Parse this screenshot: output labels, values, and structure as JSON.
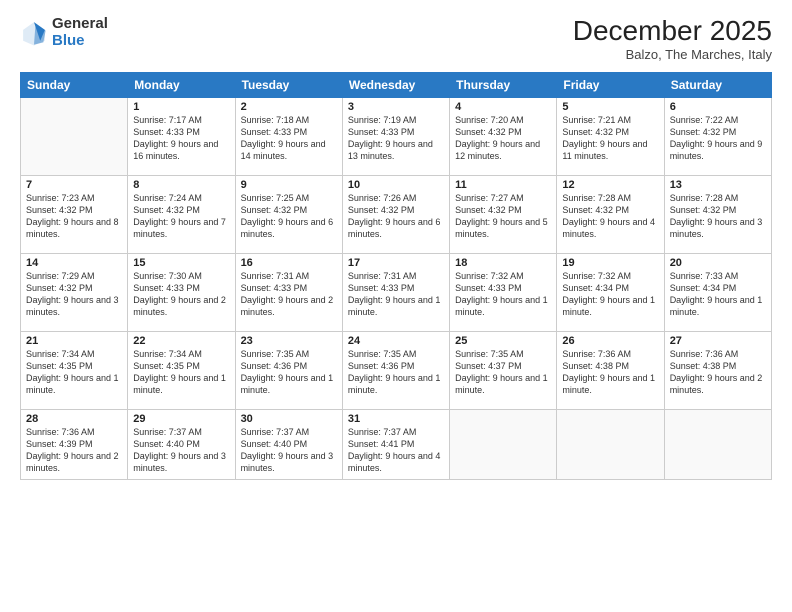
{
  "logo": {
    "general": "General",
    "blue": "Blue"
  },
  "header": {
    "title": "December 2025",
    "subtitle": "Balzo, The Marches, Italy"
  },
  "weekdays": [
    "Sunday",
    "Monday",
    "Tuesday",
    "Wednesday",
    "Thursday",
    "Friday",
    "Saturday"
  ],
  "weeks": [
    [
      {
        "day": "",
        "sunrise": "",
        "sunset": "",
        "daylight": ""
      },
      {
        "day": "1",
        "sunrise": "Sunrise: 7:17 AM",
        "sunset": "Sunset: 4:33 PM",
        "daylight": "Daylight: 9 hours and 16 minutes."
      },
      {
        "day": "2",
        "sunrise": "Sunrise: 7:18 AM",
        "sunset": "Sunset: 4:33 PM",
        "daylight": "Daylight: 9 hours and 14 minutes."
      },
      {
        "day": "3",
        "sunrise": "Sunrise: 7:19 AM",
        "sunset": "Sunset: 4:33 PM",
        "daylight": "Daylight: 9 hours and 13 minutes."
      },
      {
        "day": "4",
        "sunrise": "Sunrise: 7:20 AM",
        "sunset": "Sunset: 4:32 PM",
        "daylight": "Daylight: 9 hours and 12 minutes."
      },
      {
        "day": "5",
        "sunrise": "Sunrise: 7:21 AM",
        "sunset": "Sunset: 4:32 PM",
        "daylight": "Daylight: 9 hours and 11 minutes."
      },
      {
        "day": "6",
        "sunrise": "Sunrise: 7:22 AM",
        "sunset": "Sunset: 4:32 PM",
        "daylight": "Daylight: 9 hours and 9 minutes."
      }
    ],
    [
      {
        "day": "7",
        "sunrise": "Sunrise: 7:23 AM",
        "sunset": "Sunset: 4:32 PM",
        "daylight": "Daylight: 9 hours and 8 minutes."
      },
      {
        "day": "8",
        "sunrise": "Sunrise: 7:24 AM",
        "sunset": "Sunset: 4:32 PM",
        "daylight": "Daylight: 9 hours and 7 minutes."
      },
      {
        "day": "9",
        "sunrise": "Sunrise: 7:25 AM",
        "sunset": "Sunset: 4:32 PM",
        "daylight": "Daylight: 9 hours and 6 minutes."
      },
      {
        "day": "10",
        "sunrise": "Sunrise: 7:26 AM",
        "sunset": "Sunset: 4:32 PM",
        "daylight": "Daylight: 9 hours and 6 minutes."
      },
      {
        "day": "11",
        "sunrise": "Sunrise: 7:27 AM",
        "sunset": "Sunset: 4:32 PM",
        "daylight": "Daylight: 9 hours and 5 minutes."
      },
      {
        "day": "12",
        "sunrise": "Sunrise: 7:28 AM",
        "sunset": "Sunset: 4:32 PM",
        "daylight": "Daylight: 9 hours and 4 minutes."
      },
      {
        "day": "13",
        "sunrise": "Sunrise: 7:28 AM",
        "sunset": "Sunset: 4:32 PM",
        "daylight": "Daylight: 9 hours and 3 minutes."
      }
    ],
    [
      {
        "day": "14",
        "sunrise": "Sunrise: 7:29 AM",
        "sunset": "Sunset: 4:32 PM",
        "daylight": "Daylight: 9 hours and 3 minutes."
      },
      {
        "day": "15",
        "sunrise": "Sunrise: 7:30 AM",
        "sunset": "Sunset: 4:33 PM",
        "daylight": "Daylight: 9 hours and 2 minutes."
      },
      {
        "day": "16",
        "sunrise": "Sunrise: 7:31 AM",
        "sunset": "Sunset: 4:33 PM",
        "daylight": "Daylight: 9 hours and 2 minutes."
      },
      {
        "day": "17",
        "sunrise": "Sunrise: 7:31 AM",
        "sunset": "Sunset: 4:33 PM",
        "daylight": "Daylight: 9 hours and 1 minute."
      },
      {
        "day": "18",
        "sunrise": "Sunrise: 7:32 AM",
        "sunset": "Sunset: 4:33 PM",
        "daylight": "Daylight: 9 hours and 1 minute."
      },
      {
        "day": "19",
        "sunrise": "Sunrise: 7:32 AM",
        "sunset": "Sunset: 4:34 PM",
        "daylight": "Daylight: 9 hours and 1 minute."
      },
      {
        "day": "20",
        "sunrise": "Sunrise: 7:33 AM",
        "sunset": "Sunset: 4:34 PM",
        "daylight": "Daylight: 9 hours and 1 minute."
      }
    ],
    [
      {
        "day": "21",
        "sunrise": "Sunrise: 7:34 AM",
        "sunset": "Sunset: 4:35 PM",
        "daylight": "Daylight: 9 hours and 1 minute."
      },
      {
        "day": "22",
        "sunrise": "Sunrise: 7:34 AM",
        "sunset": "Sunset: 4:35 PM",
        "daylight": "Daylight: 9 hours and 1 minute."
      },
      {
        "day": "23",
        "sunrise": "Sunrise: 7:35 AM",
        "sunset": "Sunset: 4:36 PM",
        "daylight": "Daylight: 9 hours and 1 minute."
      },
      {
        "day": "24",
        "sunrise": "Sunrise: 7:35 AM",
        "sunset": "Sunset: 4:36 PM",
        "daylight": "Daylight: 9 hours and 1 minute."
      },
      {
        "day": "25",
        "sunrise": "Sunrise: 7:35 AM",
        "sunset": "Sunset: 4:37 PM",
        "daylight": "Daylight: 9 hours and 1 minute."
      },
      {
        "day": "26",
        "sunrise": "Sunrise: 7:36 AM",
        "sunset": "Sunset: 4:38 PM",
        "daylight": "Daylight: 9 hours and 1 minute."
      },
      {
        "day": "27",
        "sunrise": "Sunrise: 7:36 AM",
        "sunset": "Sunset: 4:38 PM",
        "daylight": "Daylight: 9 hours and 2 minutes."
      }
    ],
    [
      {
        "day": "28",
        "sunrise": "Sunrise: 7:36 AM",
        "sunset": "Sunset: 4:39 PM",
        "daylight": "Daylight: 9 hours and 2 minutes."
      },
      {
        "day": "29",
        "sunrise": "Sunrise: 7:37 AM",
        "sunset": "Sunset: 4:40 PM",
        "daylight": "Daylight: 9 hours and 3 minutes."
      },
      {
        "day": "30",
        "sunrise": "Sunrise: 7:37 AM",
        "sunset": "Sunset: 4:40 PM",
        "daylight": "Daylight: 9 hours and 3 minutes."
      },
      {
        "day": "31",
        "sunrise": "Sunrise: 7:37 AM",
        "sunset": "Sunset: 4:41 PM",
        "daylight": "Daylight: 9 hours and 4 minutes."
      },
      {
        "day": "",
        "sunrise": "",
        "sunset": "",
        "daylight": ""
      },
      {
        "day": "",
        "sunrise": "",
        "sunset": "",
        "daylight": ""
      },
      {
        "day": "",
        "sunrise": "",
        "sunset": "",
        "daylight": ""
      }
    ]
  ]
}
